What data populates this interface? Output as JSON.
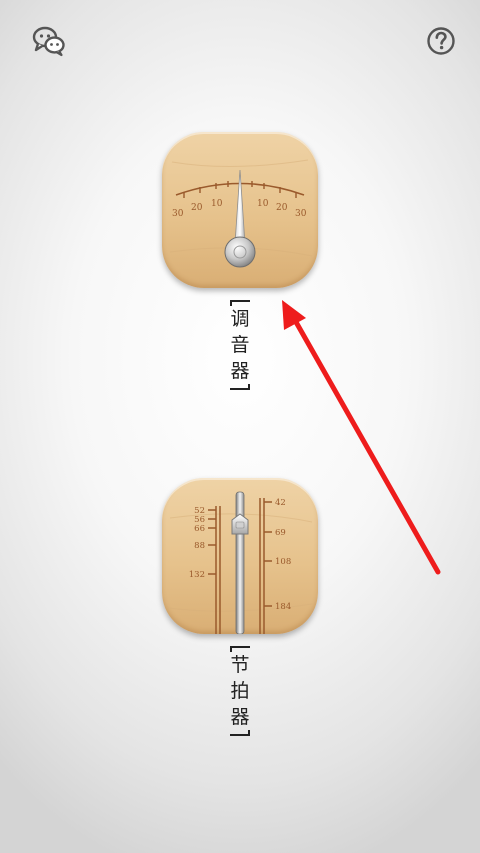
{
  "header": {
    "left_icon": "wechat-share-icon",
    "right_icon": "help-icon"
  },
  "tuner": {
    "icon": "tuner-dial-icon",
    "label_chars": [
      "调",
      "音",
      "器"
    ],
    "scale_left": [
      "30",
      "20",
      "10"
    ],
    "scale_right": [
      "10",
      "20",
      "30"
    ]
  },
  "metronome": {
    "icon": "metronome-slider-icon",
    "label_chars": [
      "节",
      "拍",
      "器"
    ],
    "left_scale": [
      "52",
      "56",
      "66",
      "88",
      "132"
    ],
    "right_scale": [
      "42",
      "69",
      "108",
      "184"
    ]
  },
  "annotation": {
    "arrow_color": "#ee1c1c"
  },
  "colors": {
    "wood_light": "#efd3a6",
    "wood_dark": "#d9ae74",
    "scale_brown": "#9a5a2c",
    "icon_gray": "#555555"
  }
}
